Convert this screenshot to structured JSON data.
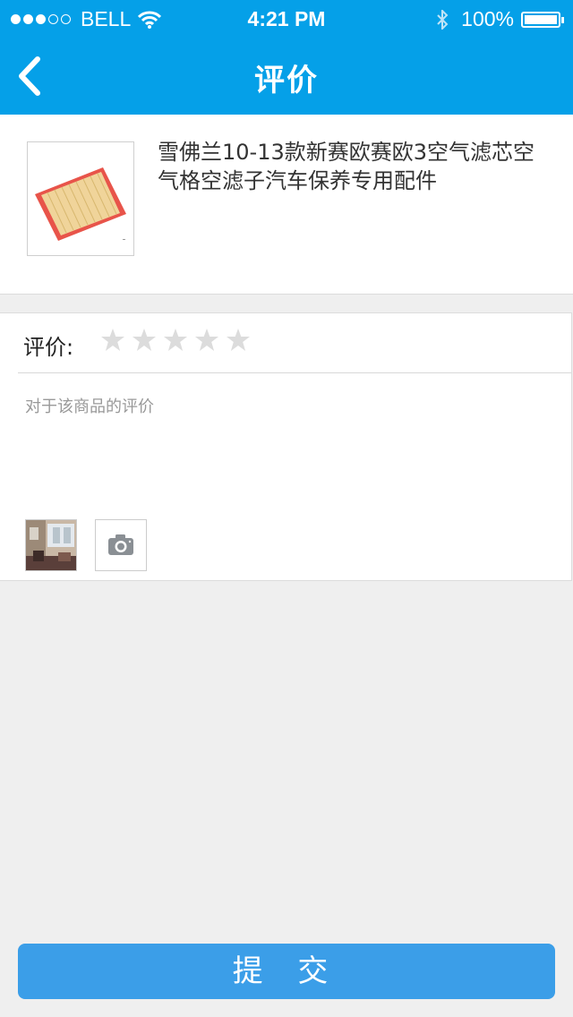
{
  "status_bar": {
    "carrier": "BELL",
    "time": "4:21 PM",
    "battery": "100%"
  },
  "nav": {
    "title": "评价",
    "back_icon": "chevron-left-icon"
  },
  "product": {
    "title": "雪佛兰10-13款新赛欧赛欧3空气滤芯空气格空滤子汽车保养专用配件",
    "image": "air-filter-product-image"
  },
  "review": {
    "rating_label": "评价:",
    "stars": 5,
    "rating_value": 0,
    "star_color": "#dcdcdc",
    "comment_placeholder": "对于该商品的评价",
    "camera_icon": "camera-icon"
  },
  "submit_label": "提 交",
  "colors": {
    "nav_bg": "#05a0e8",
    "submit_bg": "#3b9ee8",
    "page_bg": "#efefef"
  }
}
